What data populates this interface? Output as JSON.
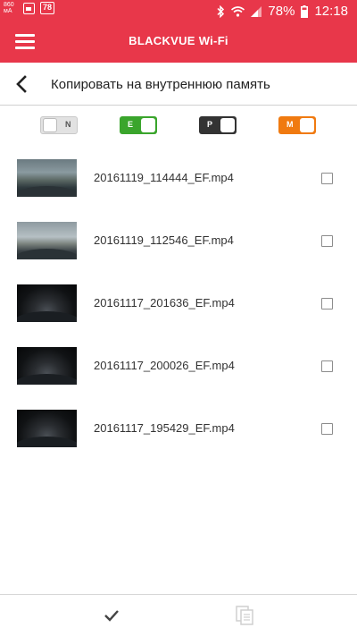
{
  "status_bar": {
    "data_speed": "860 мА",
    "badge": "78",
    "battery_pct": "78%",
    "time": "12:18"
  },
  "app_bar": {
    "title": "BLACKVUE Wi-Fi",
    "menu_icon": "hamburger-menu-icon",
    "color": "#e8374a"
  },
  "header": {
    "title": "Копировать на внутреннюю память",
    "back_icon": "back-arrow-icon"
  },
  "filters": [
    {
      "label": "N",
      "on": false,
      "color": "#e2e2e2"
    },
    {
      "label": "E",
      "on": true,
      "color": "#3aa52c"
    },
    {
      "label": "P",
      "on": true,
      "color": "#333333"
    },
    {
      "label": "M",
      "on": true,
      "color": "#f07a10"
    }
  ],
  "files": [
    {
      "name": "20161119_114444_EF.mp4",
      "checked": false,
      "thumb": "day"
    },
    {
      "name": "20161119_112546_EF.mp4",
      "checked": false,
      "thumb": "day"
    },
    {
      "name": "20161117_201636_EF.mp4",
      "checked": false,
      "thumb": "night"
    },
    {
      "name": "20161117_200026_EF.mp4",
      "checked": false,
      "thumb": "night"
    },
    {
      "name": "20161117_195429_EF.mp4",
      "checked": false,
      "thumb": "night"
    }
  ],
  "bottom_bar": {
    "confirm_icon": "checkmark-icon",
    "copy_icon": "copy-icon"
  }
}
